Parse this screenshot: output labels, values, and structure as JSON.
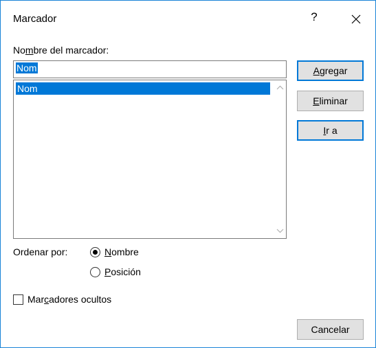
{
  "window": {
    "title": "Marcador",
    "help_label": "?"
  },
  "bookmark_name": {
    "label_pre": "No",
    "label_key": "m",
    "label_post": "bre del marcador:",
    "value": "Nom"
  },
  "list": {
    "items": [
      "Nom"
    ],
    "selected_index": 0
  },
  "buttons": {
    "add": {
      "pre": "",
      "key": "A",
      "post": "gregar"
    },
    "delete": {
      "pre": "",
      "key": "E",
      "post": "liminar"
    },
    "goto": {
      "pre": "",
      "key": "I",
      "post": "r a"
    },
    "cancel": "Cancelar"
  },
  "sort": {
    "label": "Ordenar por:",
    "selected": "name",
    "name_option": {
      "pre": "",
      "key": "N",
      "post": "ombre"
    },
    "position_option": {
      "pre": "",
      "key": "P",
      "post": "osición"
    }
  },
  "hidden_bookmarks": {
    "pre": "Mar",
    "key": "c",
    "post": "adores ocultos",
    "checked": false
  },
  "colors": {
    "accent": "#0078d7",
    "border": "#1883d7",
    "button_bg": "#e1e1e1"
  },
  "icons": {
    "close": "close-icon",
    "scroll_up": "chevron-up-icon",
    "scroll_down": "chevron-down-icon"
  }
}
